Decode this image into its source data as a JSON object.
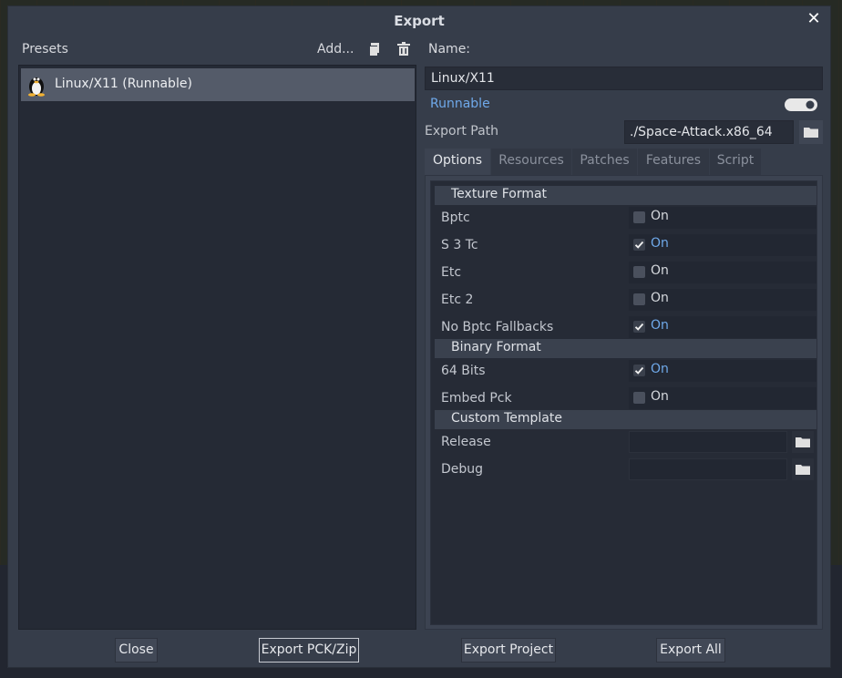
{
  "dialog": {
    "title": "Export"
  },
  "presets": {
    "label": "Presets",
    "add_label": "Add...",
    "items": [
      {
        "label": "Linux/X11 (Runnable)",
        "icon": "tux-linux-icon"
      }
    ]
  },
  "details": {
    "name_label": "Name:",
    "name_value": "Linux/X11",
    "runnable_label": "Runnable",
    "runnable_on": true,
    "export_path_label": "Export Path",
    "export_path_value": "./Space-Attack.x86_64"
  },
  "tabs": [
    "Options",
    "Resources",
    "Patches",
    "Features",
    "Script"
  ],
  "active_tab": "Options",
  "options": {
    "texture_format": {
      "title": "Texture Format",
      "props": [
        {
          "label": "Bptc",
          "checked": false,
          "text": "On"
        },
        {
          "label": "S 3 Tc",
          "checked": true,
          "text": "On"
        },
        {
          "label": "Etc",
          "checked": false,
          "text": "On"
        },
        {
          "label": "Etc 2",
          "checked": false,
          "text": "On"
        },
        {
          "label": "No Bptc Fallbacks",
          "checked": true,
          "text": "On"
        }
      ]
    },
    "binary_format": {
      "title": "Binary Format",
      "props": [
        {
          "label": "64 Bits",
          "checked": true,
          "text": "On"
        },
        {
          "label": "Embed Pck",
          "checked": false,
          "text": "On"
        }
      ]
    },
    "custom_template": {
      "title": "Custom Template",
      "props": [
        {
          "label": "Release",
          "value": ""
        },
        {
          "label": "Debug",
          "value": ""
        }
      ]
    }
  },
  "footer": {
    "close_label": "Close",
    "export_pck_label": "Export PCK/Zip",
    "export_project_label": "Export Project",
    "export_all_label": "Export All"
  },
  "colors": {
    "accent": "#6fa9ea",
    "panel": "#363d4a",
    "list_bg": "#252a35"
  }
}
